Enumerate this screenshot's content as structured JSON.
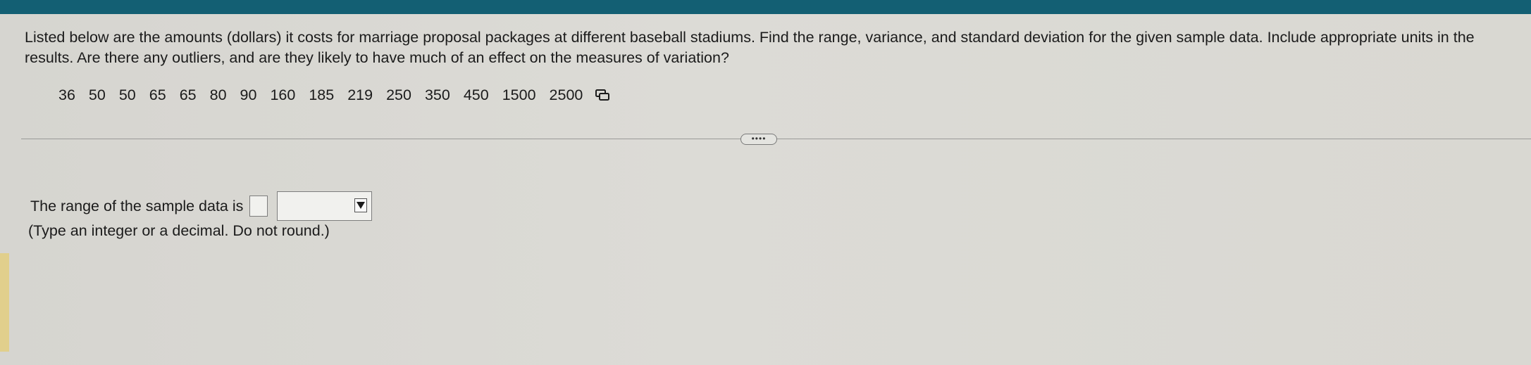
{
  "question": {
    "text": "Listed below are the amounts (dollars) it costs for marriage proposal packages at different baseball stadiums. Find the range, variance, and standard deviation for the given sample data. Include appropriate units in the results. Are there any outliers, and are they likely to have much of an effect on the measures of variation?"
  },
  "data_values": [
    "36",
    "50",
    "50",
    "65",
    "65",
    "80",
    "90",
    "160",
    "185",
    "219",
    "250",
    "350",
    "450",
    "1500",
    "2500"
  ],
  "more_button": {
    "label": "••••"
  },
  "answer": {
    "prompt": "The range of the sample data is",
    "input_value": "",
    "unit_selected": "",
    "hint": "(Type an integer or a decimal. Do not round.)"
  },
  "icons": {
    "copy": "copy-data-icon",
    "dropdown": "dropdown-arrow-icon"
  },
  "colors": {
    "top_bar": "#135f73",
    "background": "#d9d8d3",
    "accent": "#e1cf8c"
  }
}
